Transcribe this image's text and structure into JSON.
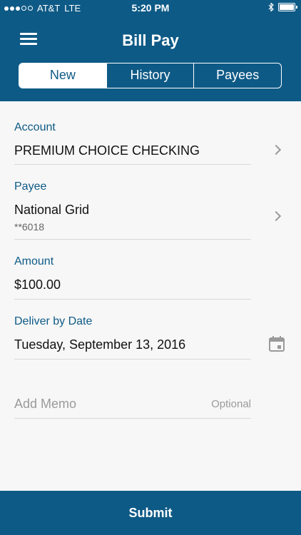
{
  "status": {
    "carrier": "AT&T",
    "network": "LTE",
    "time": "5:20 PM"
  },
  "header": {
    "title": "Bill Pay",
    "tabs": [
      {
        "label": "New",
        "active": true
      },
      {
        "label": "History",
        "active": false
      },
      {
        "label": "Payees",
        "active": false
      }
    ]
  },
  "form": {
    "account": {
      "label": "Account",
      "value": "PREMIUM CHOICE CHECKING"
    },
    "payee": {
      "label": "Payee",
      "value": "National Grid",
      "sub": "**6018"
    },
    "amount": {
      "label": "Amount",
      "value": "$100.00"
    },
    "deliver": {
      "label": "Deliver by Date",
      "value": "Tuesday, September 13, 2016"
    },
    "memo": {
      "placeholder": "Add Memo",
      "hint": "Optional"
    }
  },
  "footer": {
    "submit_label": "Submit"
  },
  "colors": {
    "primary": "#0e5a86",
    "background": "#f7f7f7"
  },
  "icons": [
    "menu-icon",
    "chevron-right-icon",
    "calendar-icon",
    "bluetooth-icon",
    "battery-icon"
  ]
}
